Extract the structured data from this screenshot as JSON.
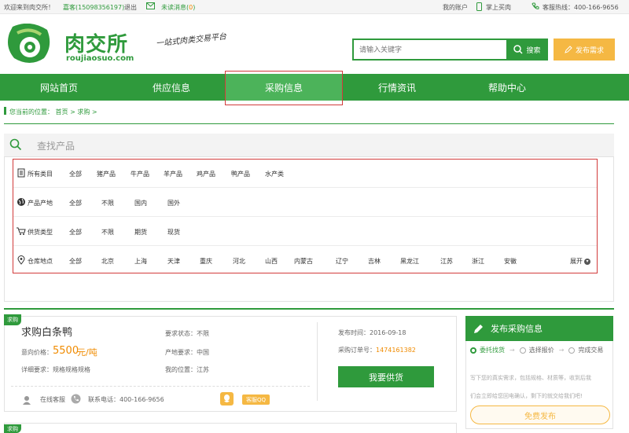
{
  "colors": {
    "brand_green": "#2f9a3c",
    "accent_orange": "#f5b843",
    "price_orange": "#f08b00",
    "highlight_red": "#d23b3b"
  },
  "topbar": {
    "welcome": "欢迎来到肉交所！",
    "user": "嘉客(15098356197)",
    "logout": "退出",
    "unread_label": "未读消息(",
    "unread_count": "0",
    "unread_close": ")",
    "my_account": "我的账户",
    "mobile": "掌上买肉",
    "hotline": "客服热线：400-166-9656"
  },
  "header": {
    "logo_cn": "肉交所",
    "logo_en": "roujiaosuo.com",
    "slogan": "一站式肉类交易平台",
    "search_placeholder": "请输入关键字",
    "search_button": "搜索",
    "publish_button": "发布需求"
  },
  "nav": {
    "items": [
      "网站首页",
      "供应信息",
      "采购信息",
      "行情资讯",
      "帮助中心"
    ],
    "active": "采购信息"
  },
  "breadcrumb": {
    "prefix": "您当前的位置：",
    "home": "首页",
    "sep1": ">",
    "current": "求购",
    "sep2": ">"
  },
  "filter": {
    "title": "查找产品",
    "rows": [
      {
        "label": "所有类目",
        "icon": "category-icon",
        "options": [
          "全部",
          "猪产品",
          "牛产品",
          "羊产品",
          "鸡产品",
          "鸭产品",
          "水产类"
        ]
      },
      {
        "label": "产品产地",
        "icon": "globe-icon",
        "options": [
          "全部",
          "不限",
          "国内",
          "国外"
        ]
      },
      {
        "label": "供货类型",
        "icon": "cart-icon",
        "options": [
          "全部",
          "不限",
          "期货",
          "现货"
        ]
      },
      {
        "label": "仓库地点",
        "icon": "location-pin-icon",
        "options": [
          "全部",
          "北京",
          "上海",
          "天津",
          "重庆",
          "河北",
          "山西",
          "内蒙古",
          "辽宁",
          "吉林",
          "黑龙江",
          "江苏",
          "浙江",
          "安徽"
        ]
      }
    ],
    "expand": "展开"
  },
  "listing": {
    "badge": "求购",
    "title": "求购白条鸭",
    "price_label": "意向价格：",
    "price_value": "5500",
    "price_unit": "元/吨",
    "detail": "详细要求：规格规格规格",
    "status": "要求状态：不限",
    "origin": "产地要求：中国",
    "location": "我的位置：江苏",
    "publish_time": "发布时间：2016-09-18",
    "order_label": "采购订单号：",
    "order_no": "1474161382",
    "supply_button": "我要供货",
    "online_service": "在线客服",
    "phone": "联系电话：400-166-9656",
    "qq": "客服QQ",
    "badge2": "求购"
  },
  "sidebar": {
    "title": "发布采购信息",
    "steps": [
      "委托找货",
      "选择报价",
      "完成交易"
    ],
    "desc1": "写下您的真实需求，包括规格、材质等，收到后我",
    "desc2": "们会立即给您回电确认，剩下的就交给我们吧!",
    "free_button": "免费发布"
  }
}
